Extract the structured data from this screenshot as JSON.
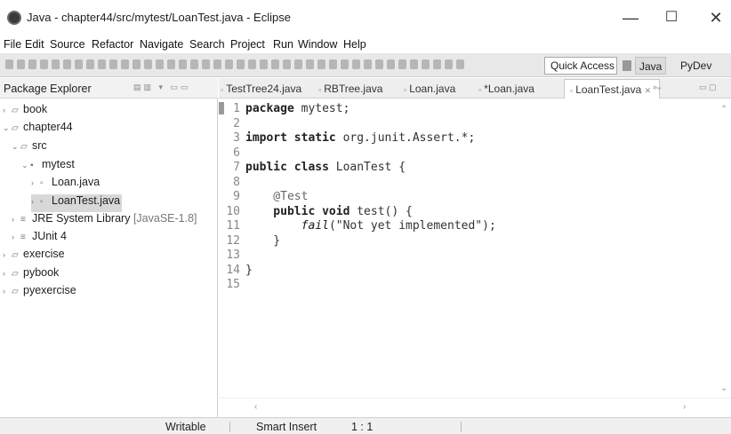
{
  "window": {
    "title": "Java - chapter44/src/mytest/LoanTest.java - Eclipse"
  },
  "menubar": {
    "items": [
      "File",
      "Edit",
      "Source",
      "Refactor",
      "Navigate",
      "Search",
      "Project",
      "Run",
      "Window",
      "Help"
    ]
  },
  "toolbar": {
    "quick_access": "Quick Access",
    "perspective_java": "Java",
    "perspective_pydev": "PyDev"
  },
  "package_explorer": {
    "title": "Package Explorer",
    "tree": [
      {
        "label": "book"
      },
      {
        "label": "chapter44"
      },
      {
        "label": "src"
      },
      {
        "label": "mytest"
      },
      {
        "label": "Loan.java"
      },
      {
        "label": "LoanTest.java"
      },
      {
        "label": "JRE System Library",
        "suffix": "[JavaSE-1.8]"
      },
      {
        "label": "JUnit 4"
      },
      {
        "label": "exercise"
      },
      {
        "label": "pybook"
      },
      {
        "label": "pyexercise"
      }
    ]
  },
  "editor": {
    "tabs": [
      "TestTree24.java",
      "RBTree.java",
      "Loan.java",
      "*Loan.java",
      "LoanTest.java"
    ],
    "lines": [
      {
        "n": "1",
        "parts": [
          {
            "t": "package",
            "c": "kw"
          },
          {
            "t": " mytest;",
            "c": "tx"
          }
        ]
      },
      {
        "n": "2",
        "parts": []
      },
      {
        "n": "3",
        "parts": [
          {
            "t": "import static",
            "c": "kw"
          },
          {
            "t": " org.junit.Assert.*;",
            "c": "tx"
          }
        ]
      },
      {
        "n": "6",
        "parts": []
      },
      {
        "n": "7",
        "parts": [
          {
            "t": "public class",
            "c": "kw"
          },
          {
            "t": " LoanTest {",
            "c": "tx"
          }
        ]
      },
      {
        "n": "8",
        "parts": []
      },
      {
        "n": "9",
        "parts": [
          {
            "t": "    @Test",
            "c": "an"
          }
        ]
      },
      {
        "n": "10",
        "parts": [
          {
            "t": "    public void",
            "c": "kw"
          },
          {
            "t": " test() {",
            "c": "tx"
          }
        ]
      },
      {
        "n": "11",
        "parts": [
          {
            "t": "        ",
            "c": "tx"
          },
          {
            "t": "fail",
            "c": "it"
          },
          {
            "t": "(\"Not yet implemented\");",
            "c": "st"
          }
        ]
      },
      {
        "n": "12",
        "parts": [
          {
            "t": "    }",
            "c": "tx"
          }
        ]
      },
      {
        "n": "13",
        "parts": []
      },
      {
        "n": "14",
        "parts": [
          {
            "t": "}",
            "c": "tx"
          }
        ]
      },
      {
        "n": "15",
        "parts": []
      }
    ]
  },
  "status": {
    "writable": "Writable",
    "insert_mode": "Smart Insert",
    "position": "1 : 1"
  }
}
